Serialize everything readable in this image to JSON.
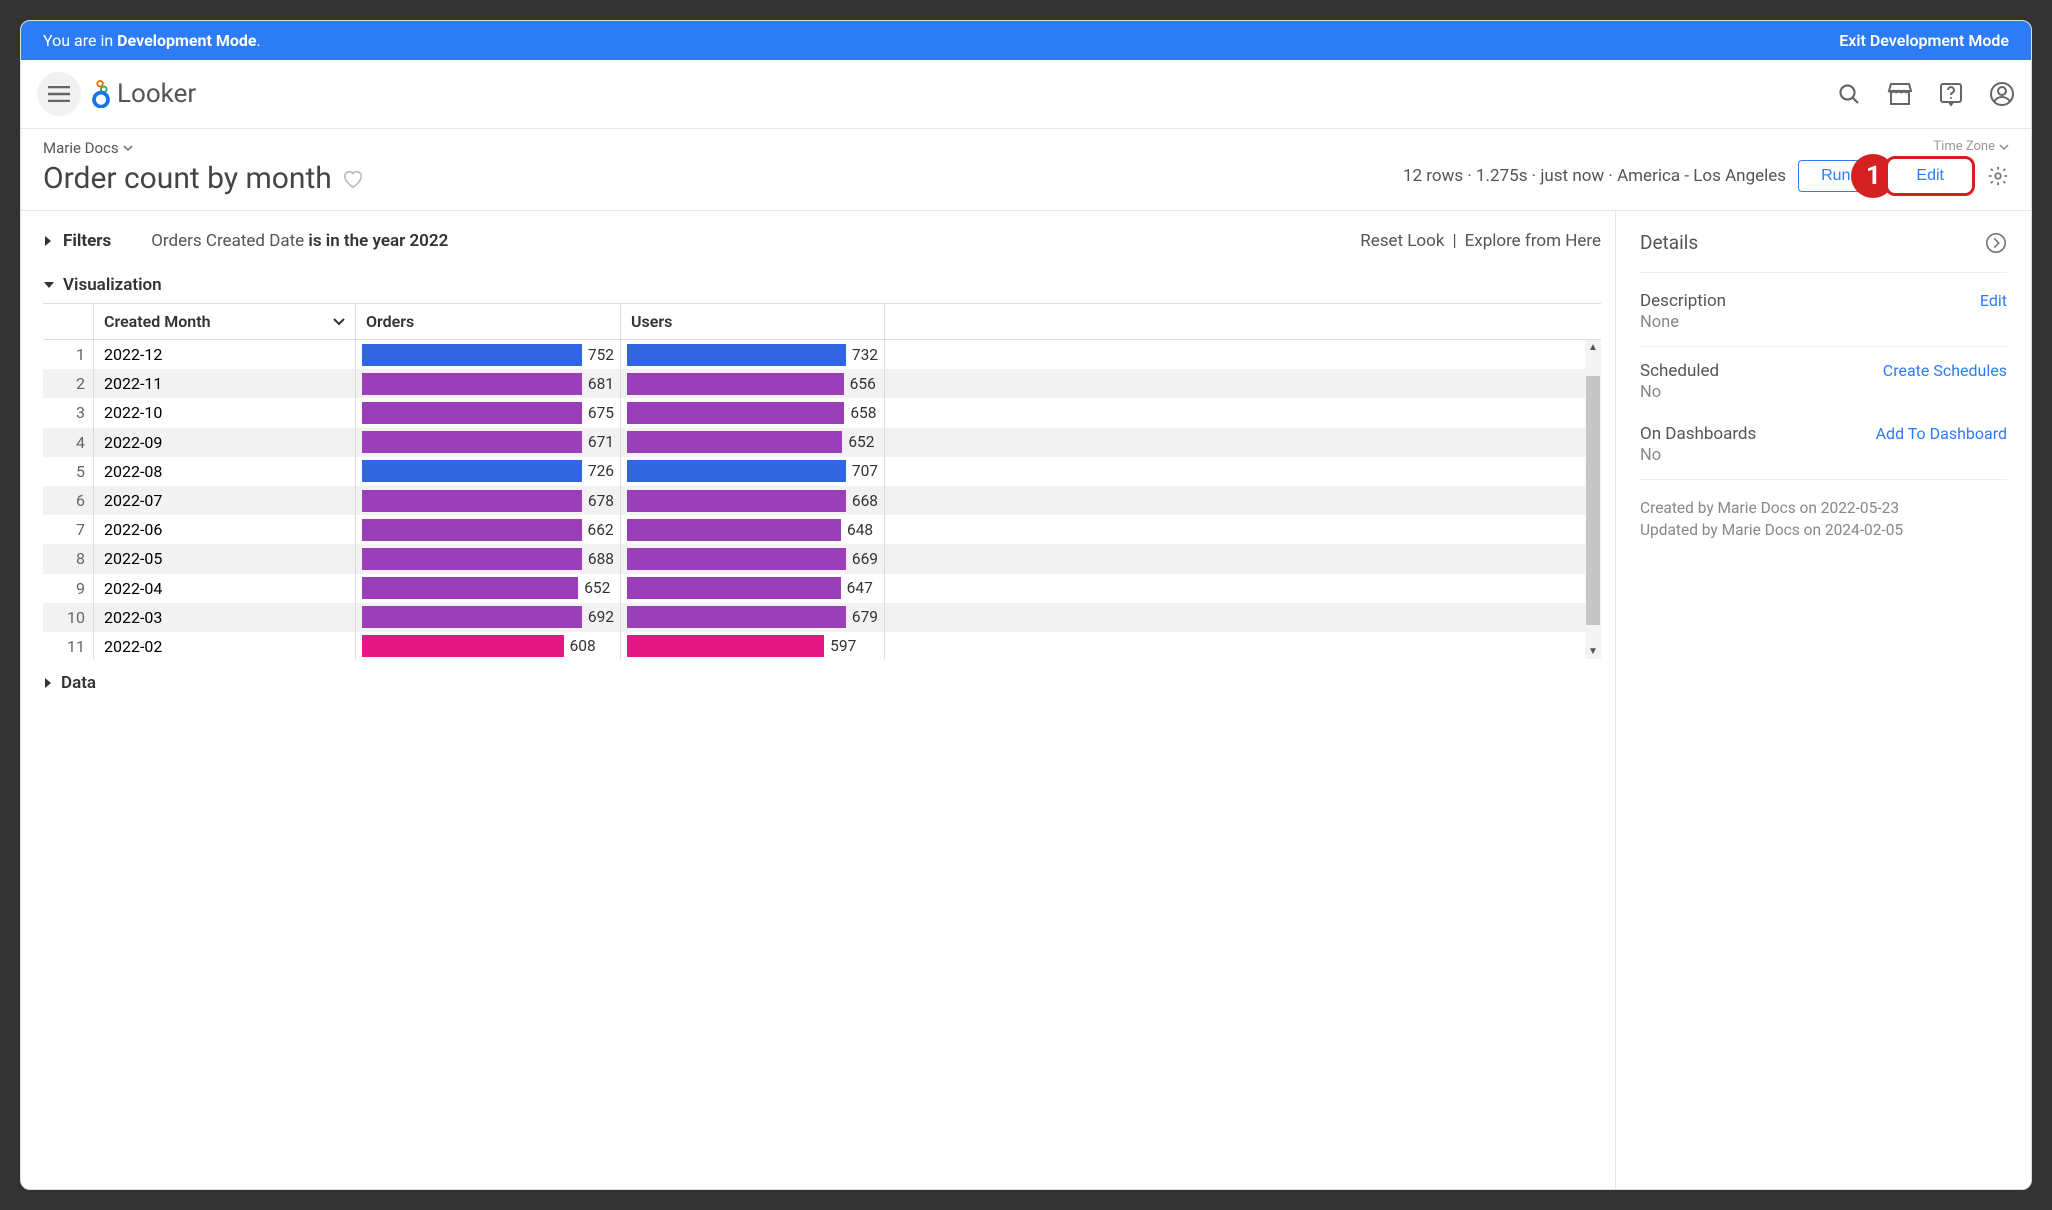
{
  "dev_banner": {
    "text_prefix": "You are in ",
    "text_bold": "Development Mode",
    "text_suffix": ".",
    "exit": "Exit Development Mode"
  },
  "brand": "Looker",
  "breadcrumb": "Marie Docs",
  "page_title": "Order count by month",
  "timezone_label": "Time Zone",
  "meta_text": "12 rows · 1.275s · just now · America - Los Angeles",
  "buttons": {
    "run": "Run",
    "edit": "Edit"
  },
  "callout_number": "1",
  "filters": {
    "label": "Filters",
    "prefix": "Orders Created Date ",
    "bold": "is in the year 2022",
    "reset": "Reset Look",
    "divider": " | ",
    "explore": "Explore from Here"
  },
  "viz": {
    "section_label": "Visualization",
    "headers": {
      "month": "Created Month",
      "orders": "Orders",
      "users": "Users"
    },
    "max_value": 760
  },
  "data_section_label": "Data",
  "side": {
    "details_label": "Details",
    "description_label": "Description",
    "description_value": "None",
    "description_action": "Edit",
    "scheduled_label": "Scheduled",
    "scheduled_value": "No",
    "scheduled_action": "Create Schedules",
    "dashboards_label": "On Dashboards",
    "dashboards_value": "No",
    "dashboards_action": "Add To Dashboard",
    "created_line": "Created by Marie Docs on 2022-05-23",
    "updated_line": "Updated by Marie Docs on 2024-02-05"
  },
  "chart_data": {
    "type": "bar",
    "title": "Order count by month",
    "xlabel": "",
    "ylabel": "",
    "categories": [
      "2022-12",
      "2022-11",
      "2022-10",
      "2022-09",
      "2022-08",
      "2022-07",
      "2022-06",
      "2022-05",
      "2022-04",
      "2022-03",
      "2022-02"
    ],
    "series": [
      {
        "name": "Orders",
        "values": [
          752,
          681,
          675,
          671,
          726,
          678,
          662,
          688,
          652,
          692,
          608
        ]
      },
      {
        "name": "Users",
        "values": [
          732,
          656,
          658,
          652,
          707,
          668,
          648,
          669,
          647,
          679,
          597
        ]
      }
    ],
    "row_colors": [
      "blue",
      "purple",
      "purple",
      "purple",
      "blue",
      "purple",
      "purple",
      "purple",
      "purple",
      "purple",
      "pink"
    ],
    "ylim": [
      0,
      760
    ]
  }
}
